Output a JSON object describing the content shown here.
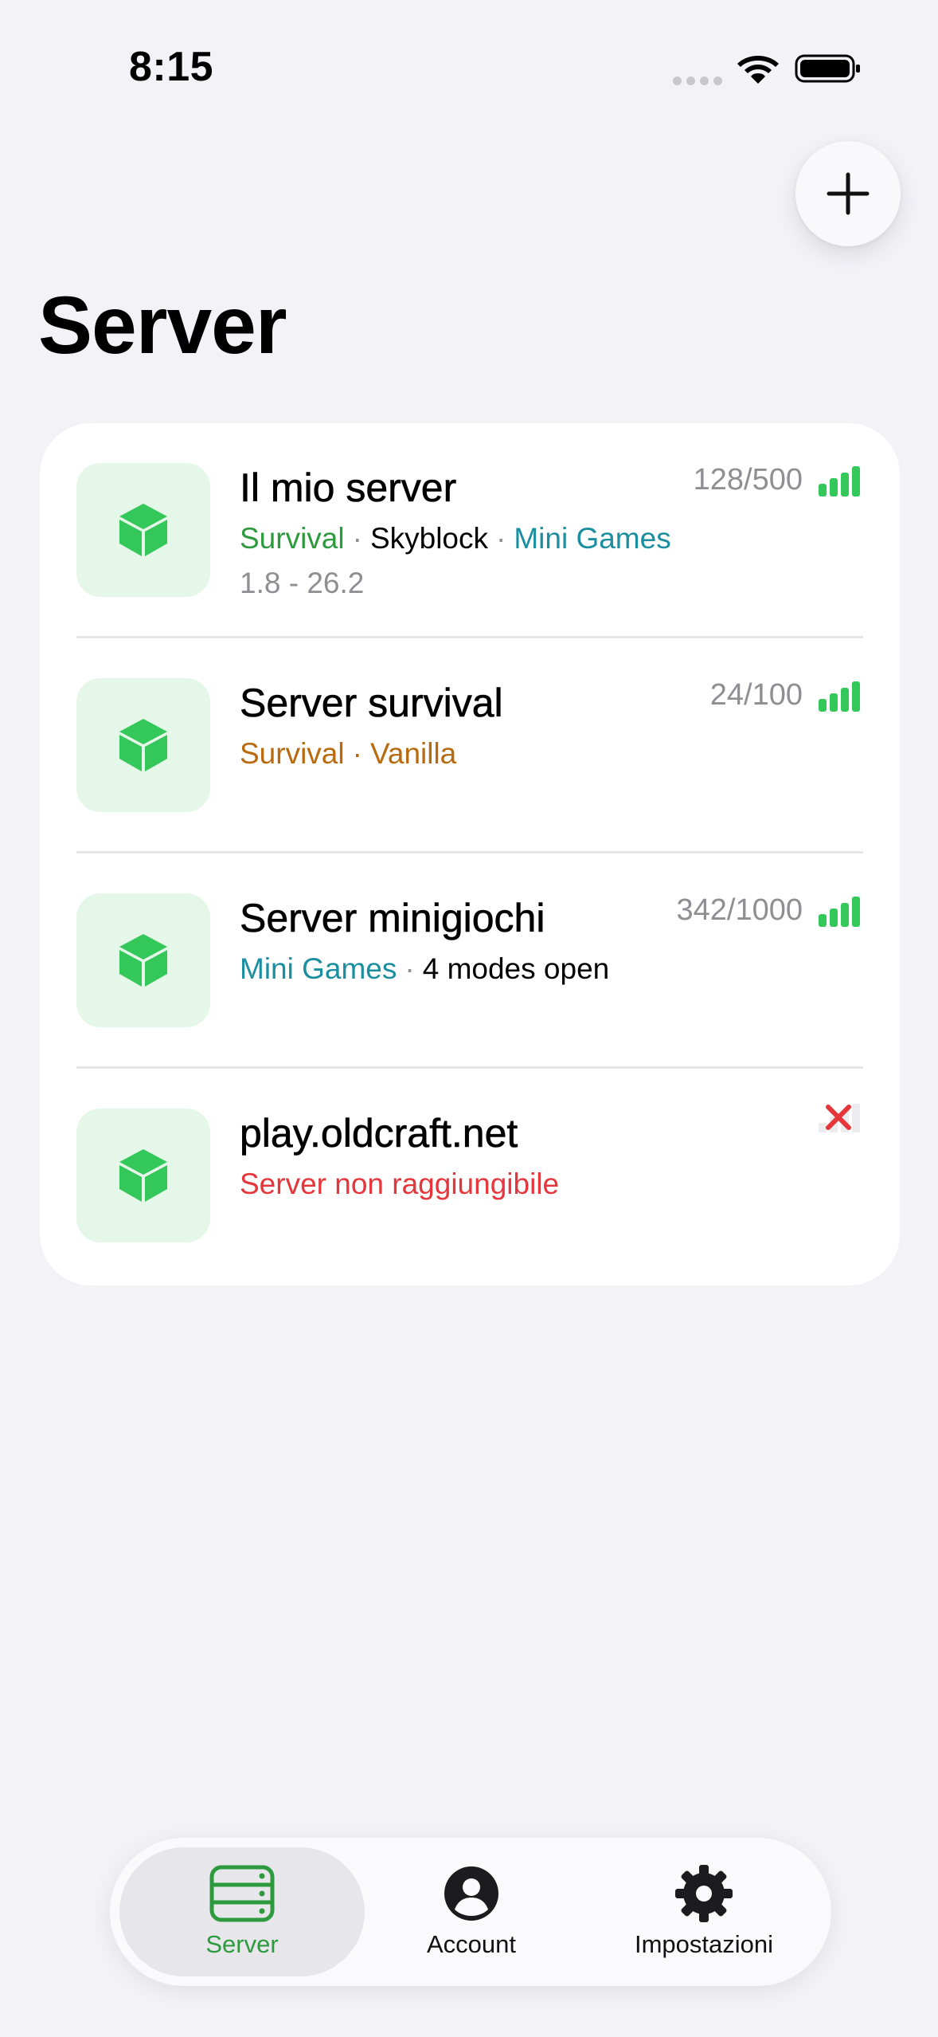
{
  "status_bar": {
    "time": "8:15"
  },
  "page": {
    "title": "Server"
  },
  "colors": {
    "accent_green": "#34c759",
    "tab_active": "#2e9a3e",
    "survival_green": "#2e9a3e",
    "survival_orange": "#b86a0e",
    "skyblock": "#000000",
    "minigames_teal": "#1b8ea0",
    "error_red": "#e5363b",
    "secondary": "#8e8e93"
  },
  "servers": [
    {
      "name": "Il mio server",
      "players": "128/500",
      "tags": [
        "Survival",
        "Skyblock",
        "Mini Games"
      ],
      "version": "1.8 - 26.2",
      "status": "online",
      "icon": "cube-icon"
    },
    {
      "name": "Server survival",
      "players": "24/100",
      "tags": [
        "Survival",
        "Vanilla"
      ],
      "status": "online",
      "icon": "cube-icon"
    },
    {
      "name": "Server minigiochi",
      "players": "342/1000",
      "tags": [
        "Mini Games",
        "4 modes open"
      ],
      "status": "online",
      "icon": "cube-icon"
    },
    {
      "name": "play.oldcraft.net",
      "status_text": "Server non raggiungibile",
      "status": "offline",
      "icon": "cube-icon"
    }
  ],
  "tabs": [
    {
      "label": "Server",
      "icon": "server-stack-icon",
      "active": true
    },
    {
      "label": "Account",
      "icon": "account-icon",
      "active": false
    },
    {
      "label": "Impostazioni",
      "icon": "gear-icon",
      "active": false
    }
  ]
}
